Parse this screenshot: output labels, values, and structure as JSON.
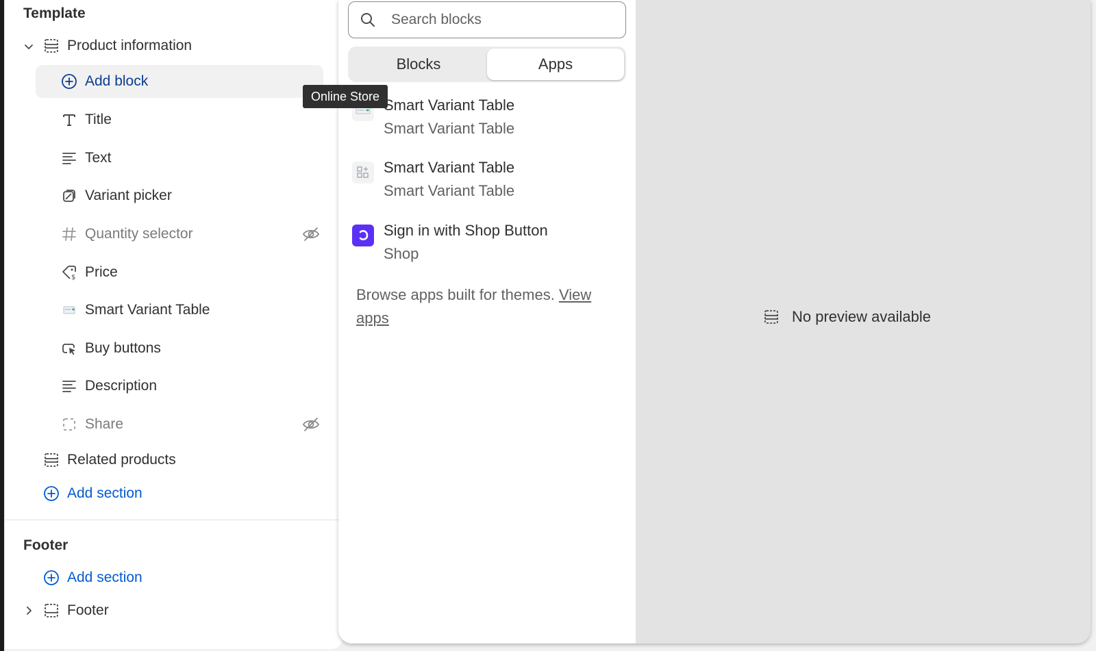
{
  "sidebar": {
    "template_heading": "Template",
    "product_information": "Product information",
    "add_block": "Add block",
    "blocks": [
      {
        "label": "Title",
        "icon": "title-icon",
        "hidden": false
      },
      {
        "label": "Text",
        "icon": "text-icon",
        "hidden": false
      },
      {
        "label": "Variant picker",
        "icon": "variant-picker-icon",
        "hidden": false
      },
      {
        "label": "Quantity selector",
        "icon": "hash-icon",
        "hidden": true
      },
      {
        "label": "Price",
        "icon": "price-tag-icon",
        "hidden": false
      },
      {
        "label": "Smart Variant Table",
        "icon": "app-block-icon",
        "hidden": false
      },
      {
        "label": "Buy buttons",
        "icon": "buy-buttons-icon",
        "hidden": false
      },
      {
        "label": "Description",
        "icon": "text-icon",
        "hidden": false
      },
      {
        "label": "Share",
        "icon": "share-icon",
        "hidden": true
      }
    ],
    "related_products": "Related products",
    "add_section_template": "Add section",
    "footer_heading": "Footer",
    "add_section_footer": "Add section",
    "footer_item": "Footer"
  },
  "tooltip": "Online Store",
  "picker": {
    "search_placeholder": "Search blocks",
    "tabs": [
      "Blocks",
      "Apps"
    ],
    "selected_tab": "Apps",
    "apps": [
      {
        "name": "Smart Variant Table",
        "vendor": "Smart Variant Table",
        "icon": "app-table-icon"
      },
      {
        "name": "Smart Variant Table",
        "vendor": "Smart Variant Table",
        "icon": "app-grid-icon"
      },
      {
        "name": "Sign in with Shop Button",
        "vendor": "Shop",
        "icon": "shop-logo-icon"
      }
    ],
    "browse_text": "Browse apps built for themes.",
    "browse_link": "View apps"
  },
  "preview": {
    "empty_text": "No preview available"
  },
  "colors": {
    "accent_blue": "#005bd3",
    "shop_purple": "#5a31f4"
  }
}
